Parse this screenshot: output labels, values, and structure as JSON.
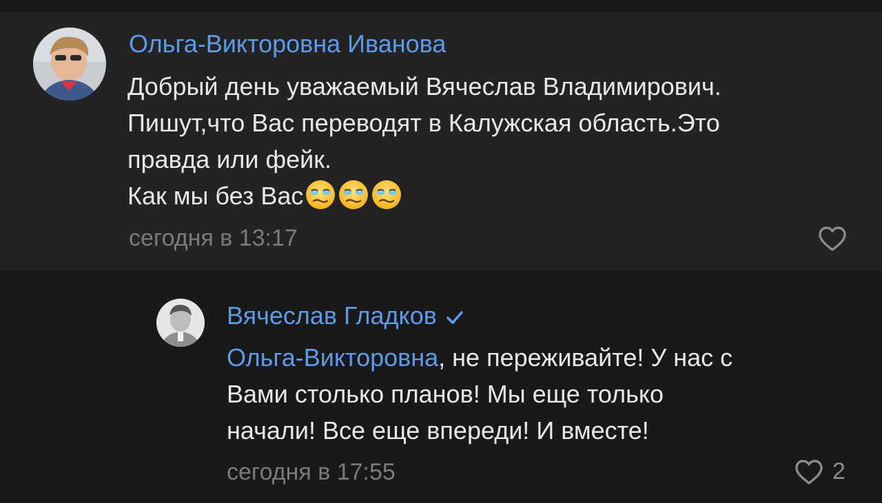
{
  "comment": {
    "author": "Ольга-Викторовна Иванова",
    "lines": [
      "Добрый день уважаемый Вячеслав Владимирович.",
      "Пишут,что Вас переводят в Калужская область.Это",
      "правда или фейк.",
      "Как мы без Вас"
    ],
    "emoji_name": "sad-relieved-face-icon",
    "emoji_count": 3,
    "timestamp": "сегодня в 13:17",
    "like_count": ""
  },
  "reply": {
    "author": "Вячеслав Гладков",
    "verified": true,
    "mention": "Ольга-Викторовна",
    "first_line_rest": ", не переживайте! У нас с",
    "lines": [
      "Вами столько планов! Мы еще только",
      "начали! Все еще впереди! И вместе!"
    ],
    "timestamp": "сегодня в 17:55",
    "like_count": "2"
  },
  "colors": {
    "background": "#19191a",
    "comment_background": "#232324",
    "accent": "#5d9be8",
    "text": "#e9e9ea",
    "muted": "#7a7b7d"
  }
}
